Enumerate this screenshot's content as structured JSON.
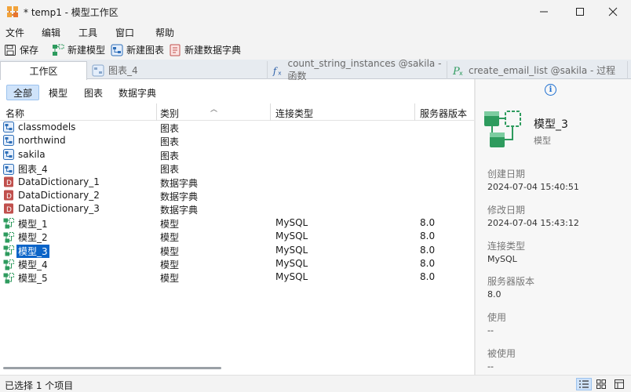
{
  "window": {
    "title": "* temp1 - 模型工作区",
    "minimize": "—",
    "maximize": "☐",
    "close": "✕"
  },
  "menu": [
    "文件",
    "编辑",
    "工具",
    "窗口",
    "帮助"
  ],
  "toolbar": {
    "save": "保存",
    "new_model": "新建模型",
    "new_diagram": "新建图表",
    "new_dictionary": "新建数据字典"
  },
  "tabs": [
    {
      "label": "工作区",
      "icon": "none",
      "active": true
    },
    {
      "label": "图表_4",
      "icon": "diagram-icon",
      "active": false
    },
    {
      "label": "count_string_instances @sakila - 函数",
      "icon": "function-icon",
      "active": false
    },
    {
      "label": "create_email_list @sakila - 过程",
      "icon": "procedure-icon",
      "active": false
    }
  ],
  "filters": [
    "全部",
    "模型",
    "图表",
    "数据字典"
  ],
  "columns": [
    "名称",
    "类别",
    "连接类型",
    "服务器版本"
  ],
  "rows": [
    {
      "name": "classmodels",
      "category": "图表",
      "conn": "",
      "version": "",
      "icon": "diagram"
    },
    {
      "name": "northwind",
      "category": "图表",
      "conn": "",
      "version": "",
      "icon": "diagram"
    },
    {
      "name": "sakila",
      "category": "图表",
      "conn": "",
      "version": "",
      "icon": "diagram"
    },
    {
      "name": "图表_4",
      "category": "图表",
      "conn": "",
      "version": "",
      "icon": "diagram"
    },
    {
      "name": "DataDictionary_1",
      "category": "数据字典",
      "conn": "",
      "version": "",
      "icon": "dictionary"
    },
    {
      "name": "DataDictionary_2",
      "category": "数据字典",
      "conn": "",
      "version": "",
      "icon": "dictionary"
    },
    {
      "name": "DataDictionary_3",
      "category": "数据字典",
      "conn": "",
      "version": "",
      "icon": "dictionary"
    },
    {
      "name": "模型_1",
      "category": "模型",
      "conn": "MySQL",
      "version": "8.0",
      "icon": "model"
    },
    {
      "name": "模型_2",
      "category": "模型",
      "conn": "MySQL",
      "version": "8.0",
      "icon": "model"
    },
    {
      "name": "模型_3",
      "category": "模型",
      "conn": "MySQL",
      "version": "8.0",
      "icon": "model",
      "selected": true
    },
    {
      "name": "模型_4",
      "category": "模型",
      "conn": "MySQL",
      "version": "8.0",
      "icon": "model"
    },
    {
      "name": "模型_5",
      "category": "模型",
      "conn": "MySQL",
      "version": "8.0",
      "icon": "model"
    }
  ],
  "info": {
    "icon_text": "i",
    "name": "模型_3",
    "type": "模型",
    "props": [
      {
        "label": "创建日期",
        "value": "2024-07-04 15:40:51"
      },
      {
        "label": "修改日期",
        "value": "2024-07-04 15:43:12"
      },
      {
        "label": "连接类型",
        "value": "MySQL"
      },
      {
        "label": "服务器版本",
        "value": "8.0"
      },
      {
        "label": "使用",
        "value": "--"
      },
      {
        "label": "被使用",
        "value": "--"
      }
    ]
  },
  "status": {
    "text": "已选择 1 个项目"
  },
  "colors": {
    "accent": "#0a64c8",
    "model_green": "#2e9b5e",
    "diagram_blue": "#2f6fb8",
    "dictionary_red": "#c0504d"
  }
}
